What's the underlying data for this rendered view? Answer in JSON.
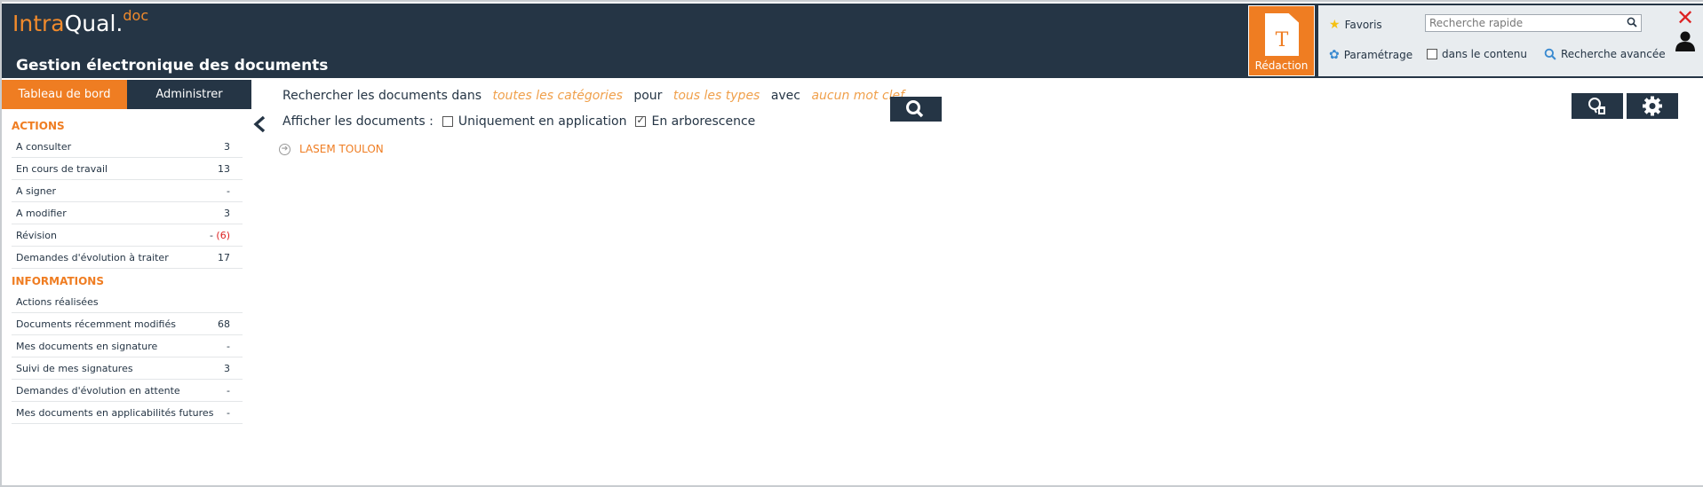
{
  "app": {
    "logo_intra": "Intra",
    "logo_qual": "Qual",
    "logo_dot": ".",
    "logo_doc": "doc",
    "title": "Gestion électronique des documents"
  },
  "redaction": {
    "label": "Rédaction",
    "icon_letter": "T"
  },
  "toolbar": {
    "favoris": "Favoris",
    "parametrage": "Paramétrage",
    "search_placeholder": "Recherche rapide",
    "dans_le_contenu": "dans le contenu",
    "recherche_avancee": "Recherche avancée"
  },
  "sidebar": {
    "tabs": [
      {
        "label": "Tableau de bord"
      },
      {
        "label": "Administrer"
      }
    ],
    "actions_title": "ACTIONS",
    "actions": [
      {
        "label": "A consulter",
        "count": "3"
      },
      {
        "label": "En cours de travail",
        "count": "13"
      },
      {
        "label": "A signer",
        "count": "-"
      },
      {
        "label": "A modifier",
        "count": "3"
      },
      {
        "label": "Révision",
        "count": "- ",
        "extra": "(6)"
      },
      {
        "label": "Demandes d'évolution à traiter",
        "count": "17"
      }
    ],
    "informations_title": "INFORMATIONS",
    "informations": [
      {
        "label": "Actions réalisées",
        "count": ""
      },
      {
        "label": "Documents récemment modifiés",
        "count": "68"
      },
      {
        "label": "Mes documents en signature",
        "count": "-"
      },
      {
        "label": "Suivi de mes signatures",
        "count": "3"
      },
      {
        "label": "Demandes d'évolution en attente",
        "count": "-"
      },
      {
        "label": "Mes documents en applicabilités futures",
        "count": "-"
      }
    ]
  },
  "search": {
    "prefix": "Rechercher les documents dans",
    "categories": "toutes les catégories",
    "pour": "pour",
    "types": "tous les types",
    "avec": "avec",
    "keyword": "aucun mot clef"
  },
  "filters": {
    "label": "Afficher les documents :",
    "only_in_application": "Uniquement en application",
    "only_in_application_checked": false,
    "tree_view": "En arborescence",
    "tree_view_checked": true
  },
  "tree": [
    {
      "label": "LASEM TOULON"
    }
  ],
  "colors": {
    "navy": "#253545",
    "orange": "#ef7d22",
    "link_orange": "#f0a04b",
    "red": "#dd2222"
  }
}
